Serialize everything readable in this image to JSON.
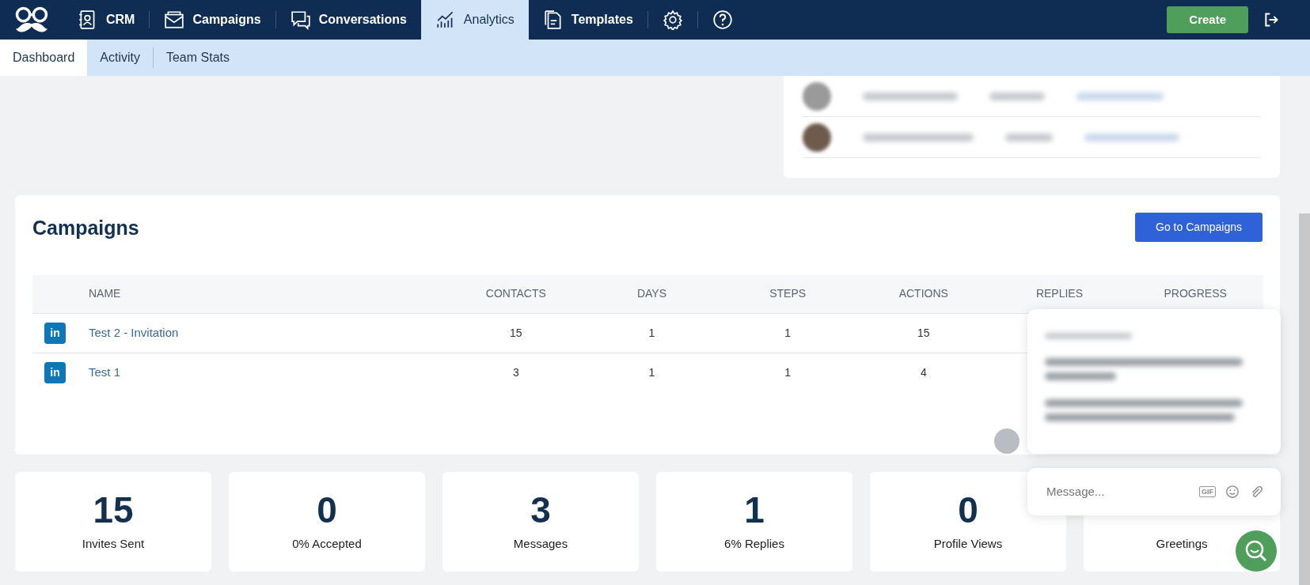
{
  "nav": {
    "tabs": [
      {
        "label": "CRM",
        "selected": false
      },
      {
        "label": "Campaigns",
        "selected": false
      },
      {
        "label": "Conversations",
        "selected": false
      },
      {
        "label": "Analytics",
        "selected": true
      },
      {
        "label": "Templates",
        "selected": false
      }
    ],
    "create_button": "Create"
  },
  "subnav": [
    {
      "label": "Dashboard",
      "selected": true
    },
    {
      "label": "Activity",
      "selected": false
    },
    {
      "label": "Team Stats",
      "selected": false
    }
  ],
  "campaigns": {
    "title": "Campaigns",
    "button": "Go to Campaigns",
    "columns": [
      "NAME",
      "CONTACTS",
      "DAYS",
      "STEPS",
      "ACTIONS",
      "REPLIES",
      "PROGRESS"
    ],
    "rows": [
      {
        "badge": "in",
        "name": "Test 2 - Invitation",
        "contacts": "15",
        "days": "1",
        "steps": "1",
        "actions": "15"
      },
      {
        "badge": "in",
        "name": "Test 1",
        "contacts": "3",
        "days": "1",
        "steps": "1",
        "actions": "4"
      }
    ]
  },
  "stats": [
    {
      "value": "15",
      "label": "Invites Sent"
    },
    {
      "value": "0",
      "label": "0% Accepted"
    },
    {
      "value": "3",
      "label": "Messages"
    },
    {
      "value": "1",
      "label": "6% Replies"
    },
    {
      "value": "0",
      "label": "Profile Views"
    },
    {
      "label": "Greetings"
    }
  ],
  "chat": {
    "placeholder": "Message...",
    "gif": "GIF"
  }
}
